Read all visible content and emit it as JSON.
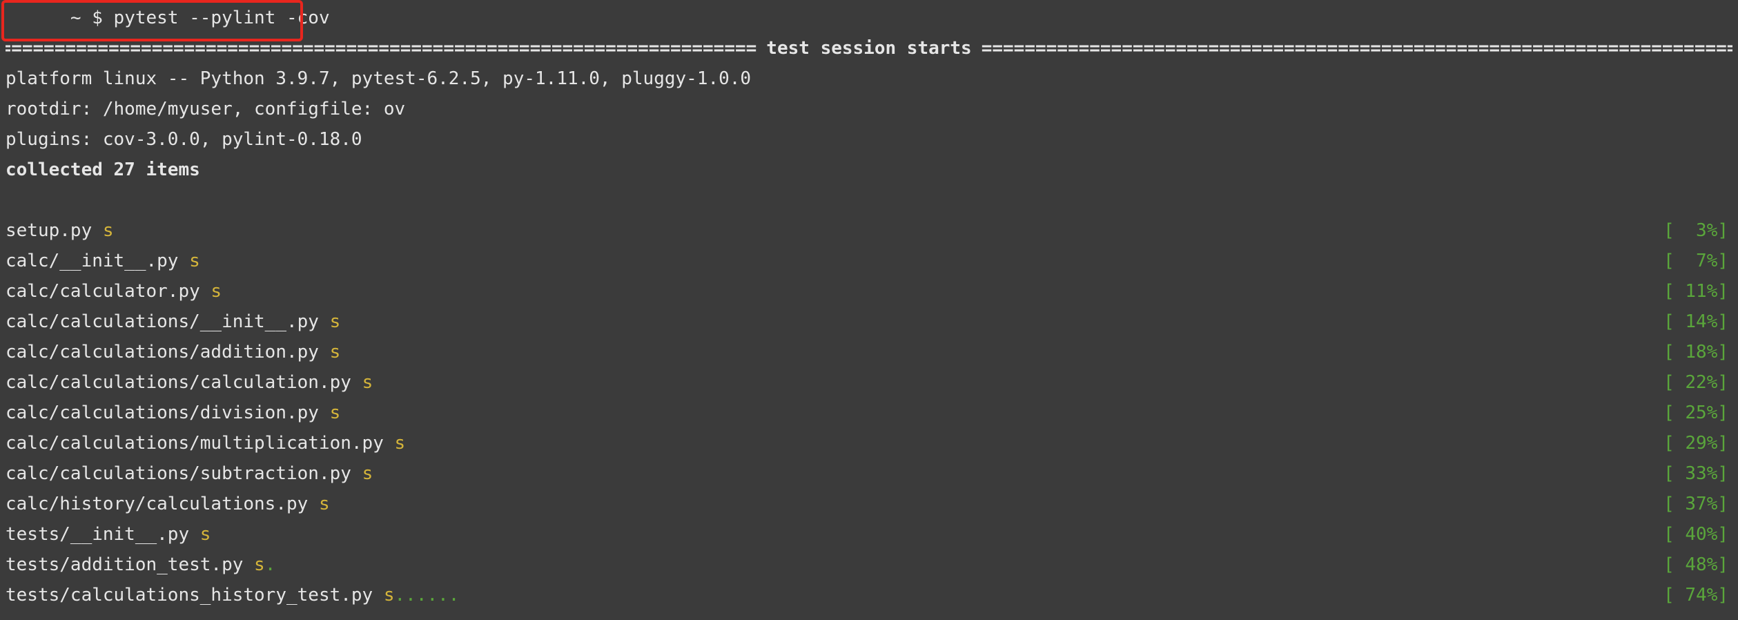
{
  "command": {
    "prompt": "~ $ ",
    "text": "pytest --pylint -cov"
  },
  "separator": {
    "title": "test session starts",
    "fill": "==============================================================================================================================================================================================================================="
  },
  "info": {
    "platform": "platform linux -- Python 3.9.7, pytest-6.2.5, py-1.11.0, pluggy-1.0.0",
    "rootdir": "rootdir: /home/myuser, configfile: ov",
    "plugins": "plugins: cov-3.0.0, pylint-0.18.0",
    "collected": "collected 27 items"
  },
  "results": [
    {
      "file": "setup.py ",
      "marks_yellow": "s",
      "marks_green": "",
      "percent": "[  3%]"
    },
    {
      "file": "calc/__init__.py ",
      "marks_yellow": "s",
      "marks_green": "",
      "percent": "[  7%]"
    },
    {
      "file": "calc/calculator.py ",
      "marks_yellow": "s",
      "marks_green": "",
      "percent": "[ 11%]"
    },
    {
      "file": "calc/calculations/__init__.py ",
      "marks_yellow": "s",
      "marks_green": "",
      "percent": "[ 14%]"
    },
    {
      "file": "calc/calculations/addition.py ",
      "marks_yellow": "s",
      "marks_green": "",
      "percent": "[ 18%]"
    },
    {
      "file": "calc/calculations/calculation.py ",
      "marks_yellow": "s",
      "marks_green": "",
      "percent": "[ 22%]"
    },
    {
      "file": "calc/calculations/division.py ",
      "marks_yellow": "s",
      "marks_green": "",
      "percent": "[ 25%]"
    },
    {
      "file": "calc/calculations/multiplication.py ",
      "marks_yellow": "s",
      "marks_green": "",
      "percent": "[ 29%]"
    },
    {
      "file": "calc/calculations/subtraction.py ",
      "marks_yellow": "s",
      "marks_green": "",
      "percent": "[ 33%]"
    },
    {
      "file": "calc/history/calculations.py ",
      "marks_yellow": "s",
      "marks_green": "",
      "percent": "[ 37%]"
    },
    {
      "file": "tests/__init__.py ",
      "marks_yellow": "s",
      "marks_green": "",
      "percent": "[ 40%]"
    },
    {
      "file": "tests/addition_test.py ",
      "marks_yellow": "s",
      "marks_green": ".",
      "percent": "[ 48%]"
    },
    {
      "file": "tests/calculations_history_test.py ",
      "marks_yellow": "s",
      "marks_green": "......",
      "percent": "[ 74%]"
    }
  ],
  "colors": {
    "background": "#3b3b3b",
    "text": "#e6e6e6",
    "skip_yellow": "#d5b53a",
    "pass_green": "#5aa63b",
    "highlight_red": "#e8261e"
  }
}
